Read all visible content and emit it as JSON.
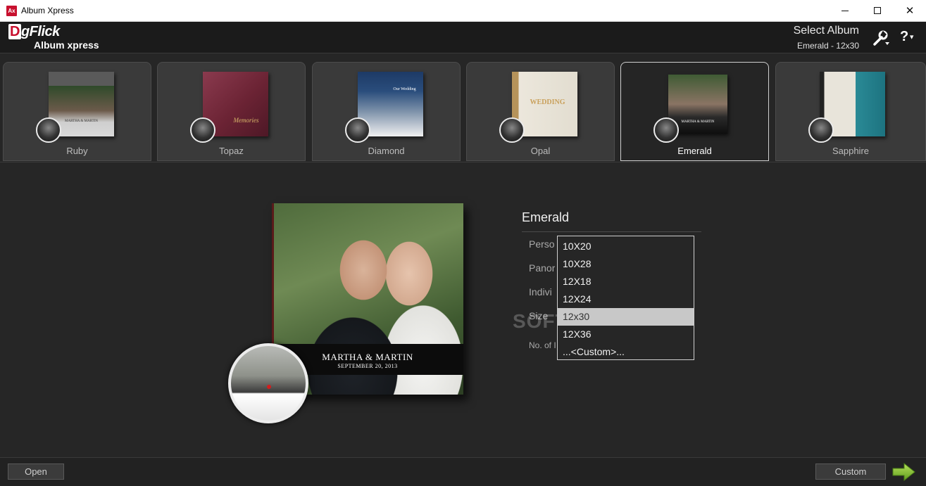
{
  "window": {
    "icon_text": "Ax",
    "title": "Album Xpress",
    "controls": {
      "minimize": "minimize",
      "maximize": "maximize",
      "close": "✕"
    }
  },
  "header": {
    "logo_brand_d": "D",
    "logo_brand_rest": "gFlick",
    "logo_product": "Album xpress",
    "select_title": "Select Album",
    "select_subtitle": "Emerald - 12x30",
    "tools_icon": "wrench-icon",
    "help_label": "?",
    "help_caret": "▼"
  },
  "albums": [
    {
      "label": "Ruby",
      "active": false,
      "thumb_text": "MARTHA & MARTIN"
    },
    {
      "label": "Topaz",
      "active": false,
      "thumb_text": "Memories"
    },
    {
      "label": "Diamond",
      "active": false,
      "thumb_text": "Our Wedding"
    },
    {
      "label": "Opal",
      "active": false,
      "thumb_text": "WEDDING"
    },
    {
      "label": "Emerald",
      "active": true,
      "thumb_text": "MARTHA & MARTIN"
    },
    {
      "label": "Sapphire",
      "active": false,
      "thumb_text": ""
    }
  ],
  "preview": {
    "names": "MARTHA & MARTIN",
    "date": "SEPTEMBER 20, 2013"
  },
  "details": {
    "title": "Emerald",
    "labels": [
      "Perso",
      "Panor",
      "Indivi",
      "Size",
      "No. of I"
    ]
  },
  "size_dropdown": {
    "options": [
      "10X20",
      "10X28",
      "12X18",
      "12X24",
      "12x30",
      "12X36",
      "...<Custom>..."
    ],
    "selected_index": 4
  },
  "watermark": "SOFTPEDIA",
  "footer": {
    "open_label": "Open",
    "custom_label": "Custom",
    "next_icon": "next-arrow-icon"
  },
  "colors": {
    "brand_red": "#c8102e",
    "background": "#262626",
    "next_green": "#8cc63f"
  }
}
